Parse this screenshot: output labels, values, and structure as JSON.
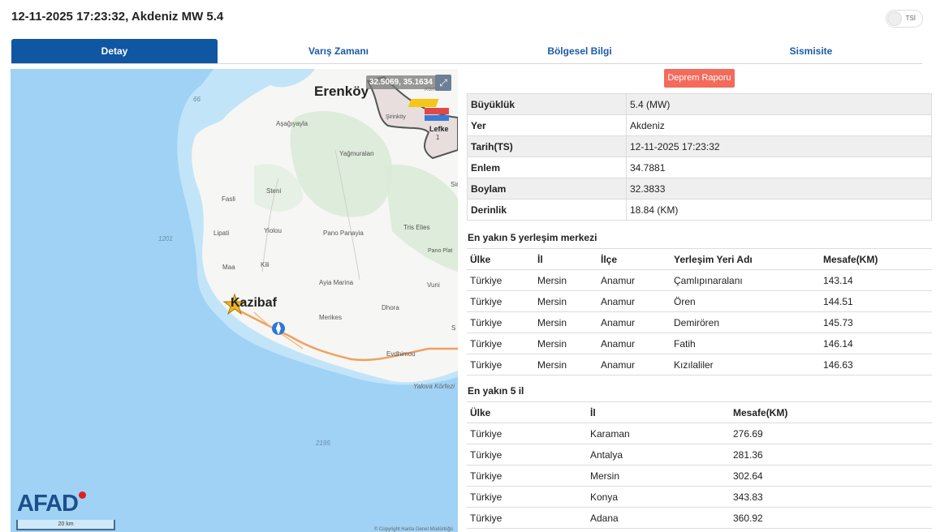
{
  "header": {
    "title": "12-11-2025 17:23:32, Akdeniz MW 5.4",
    "toggle_label": "TSİ"
  },
  "tabs": [
    "Detay",
    "Varış Zamanı",
    "Bölgesel Bilgi",
    "Sismisite"
  ],
  "map": {
    "coord_readout": "32.5069, 35.1634",
    "labels": {
      "erenkoy": "Erenköy",
      "kazibaf": "Kazibaf",
      "lefke": "Lefke",
      "korfezi_top": "Körfezi",
      "asagiyayla": "Aşağıyayla",
      "sirinkoy": "Şirinköy",
      "yagmuralan": "Yağmuralan",
      "fasli": "Fasli",
      "steni": "Steni",
      "sipati": "Lipati",
      "yiolou": "Yiolou",
      "pano_panayia": "Pano Panayia",
      "tris_elies": "Tris Elies",
      "pano_platres": "Pano Plat",
      "maa": "Maa",
      "kili": "Kili",
      "ayia_marina": "Ayia Marina",
      "vuni": "Vuni",
      "dhora": "Dhora",
      "merikes": "Merikes",
      "evdhimou": "Evdhimou",
      "yalova": "Yalova Körfezi",
      "depth66": "66",
      "depth1201": "1201",
      "depth2195": "2195",
      "sin": "Sin",
      "one": "1",
      "letter_s": "S"
    },
    "logo": "AFAD",
    "scale": "20 km",
    "copyright": "© Copyright Harita Genel Müdürlüğü"
  },
  "report_button": "Deprem Raporu",
  "details": [
    {
      "key": "Büyüklük",
      "value": "5.4 (MW)"
    },
    {
      "key": "Yer",
      "value": "Akdeniz"
    },
    {
      "key": "Tarih(TS)",
      "value": "12-11-2025 17:23:32"
    },
    {
      "key": "Enlem",
      "value": "34.7881"
    },
    {
      "key": "Boylam",
      "value": "32.3833"
    },
    {
      "key": "Derinlik",
      "value": "18.84 (KM)"
    }
  ],
  "nearest_settlements": {
    "title": "En yakın 5 yerleşim merkezi",
    "headers": [
      "Ülke",
      "İl",
      "İlçe",
      "Yerleşim Yeri Adı",
      "Mesafe(KM)"
    ],
    "rows": [
      [
        "Türkiye",
        "Mersin",
        "Anamur",
        "Çamlıpınaralanı",
        "143.14"
      ],
      [
        "Türkiye",
        "Mersin",
        "Anamur",
        "Ören",
        "144.51"
      ],
      [
        "Türkiye",
        "Mersin",
        "Anamur",
        "Demirören",
        "145.73"
      ],
      [
        "Türkiye",
        "Mersin",
        "Anamur",
        "Fatih",
        "146.14"
      ],
      [
        "Türkiye",
        "Mersin",
        "Anamur",
        "Kızılaliler",
        "146.63"
      ]
    ]
  },
  "nearest_provinces": {
    "title": "En yakın 5 il",
    "headers": [
      "Ülke",
      "İl",
      "Mesafe(KM)"
    ],
    "rows": [
      [
        "Türkiye",
        "Karaman",
        "276.69"
      ],
      [
        "Türkiye",
        "Antalya",
        "281.36"
      ],
      [
        "Türkiye",
        "Mersin",
        "302.64"
      ],
      [
        "Türkiye",
        "Konya",
        "343.83"
      ],
      [
        "Türkiye",
        "Adana",
        "360.92"
      ]
    ]
  }
}
